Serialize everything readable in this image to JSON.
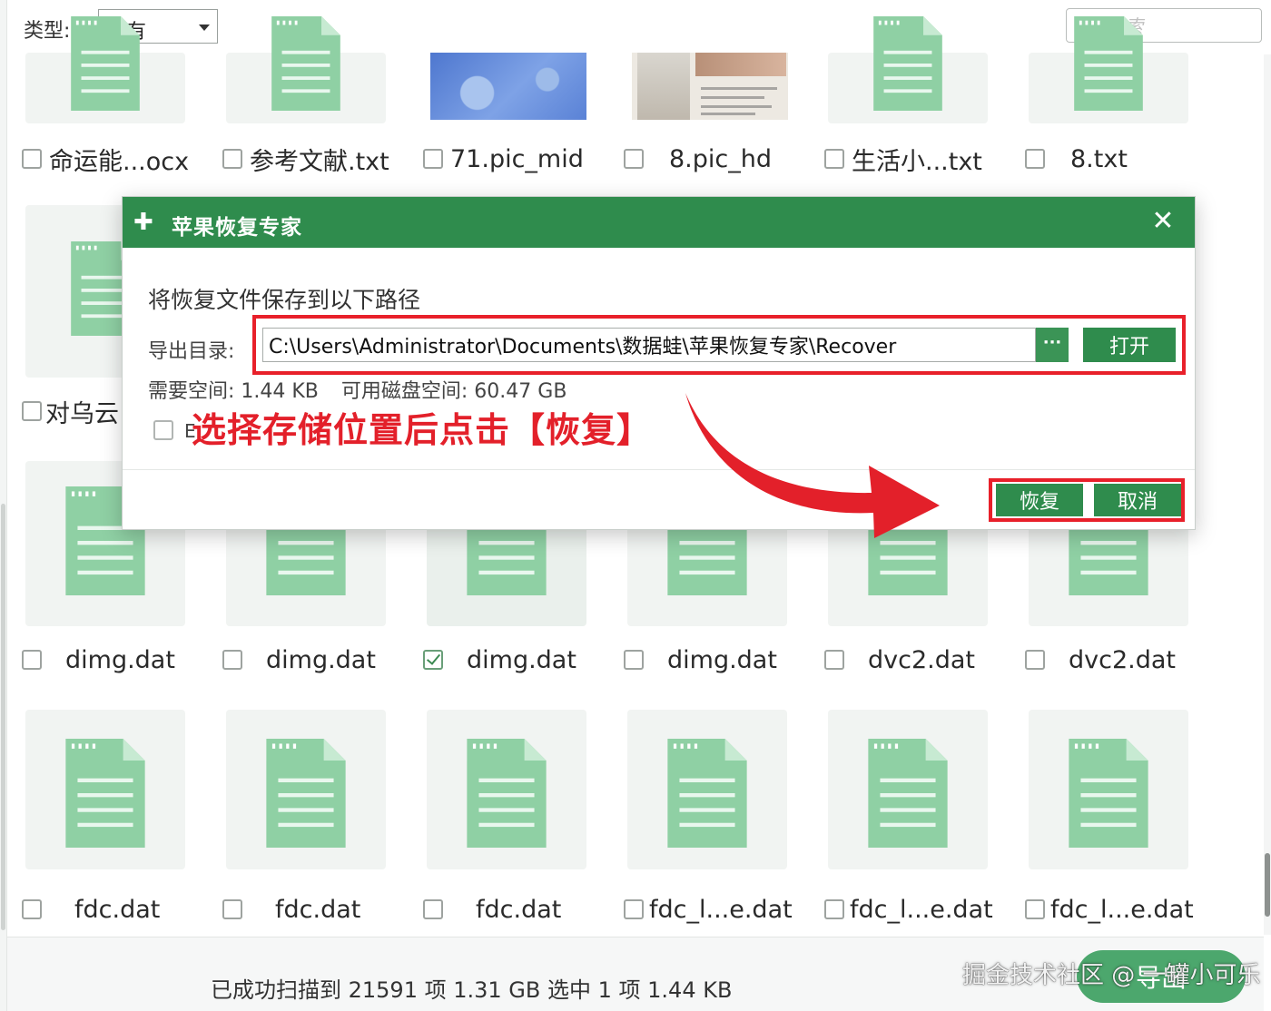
{
  "toolbar": {
    "type_label": "类型:",
    "type_value": "所有",
    "search_placeholder": "搜索"
  },
  "row1": [
    {
      "label": "命运能...ocx",
      "checked": false
    },
    {
      "label": "参考文献.txt",
      "checked": false
    },
    {
      "label": "71.pic_mid",
      "checked": false
    },
    {
      "label": "8.pic_hd",
      "checked": false
    },
    {
      "label": "生活小...txt",
      "checked": false
    },
    {
      "label": "8.txt",
      "checked": false
    }
  ],
  "row2_first": {
    "label": "对乌云",
    "checked": false
  },
  "row3": [
    {
      "label": "dimg.dat",
      "checked": false
    },
    {
      "label": "dimg.dat",
      "checked": false
    },
    {
      "label": "dimg.dat",
      "checked": true
    },
    {
      "label": "dimg.dat",
      "checked": false
    },
    {
      "label": "dvc2.dat",
      "checked": false
    },
    {
      "label": "dvc2.dat",
      "checked": false
    }
  ],
  "row4": [
    {
      "label": "fdc.dat",
      "checked": false
    },
    {
      "label": "fdc.dat",
      "checked": false
    },
    {
      "label": "fdc.dat",
      "checked": false
    },
    {
      "label": "fdc_l...e.dat",
      "checked": false
    },
    {
      "label": "fdc_l...e.dat",
      "checked": false
    },
    {
      "label": "fdc_l...e.dat",
      "checked": false
    }
  ],
  "dialog": {
    "title": "苹果恢复专家",
    "close": "✕",
    "heading": "将恢复文件保存到以下路径",
    "path_label": "导出目录:",
    "path_value": "C:\\Users\\Administrator\\Documents\\数据蛙\\苹果恢复专家\\Recover",
    "dots": "···",
    "open_label": "打开",
    "required_space": "需要空间: 1.44 KB",
    "free_space": "可用磁盘空间: 60.47 GB",
    "checkbox_text": "E",
    "annotation": "选择存储位置后点击【恢复】",
    "recover_label": "恢复",
    "cancel_label": "取消"
  },
  "status": {
    "text": "已成功扫描到 21591 项 1.31 GB  选中 1 项 1.44 KB",
    "export_label": "导出"
  },
  "watermark": "掘金技术社区 @ 一罐小可乐",
  "colors": {
    "accent": "#2f8c4d",
    "doc_icon": "#8fd0a4",
    "highlight": "#e8202a"
  }
}
